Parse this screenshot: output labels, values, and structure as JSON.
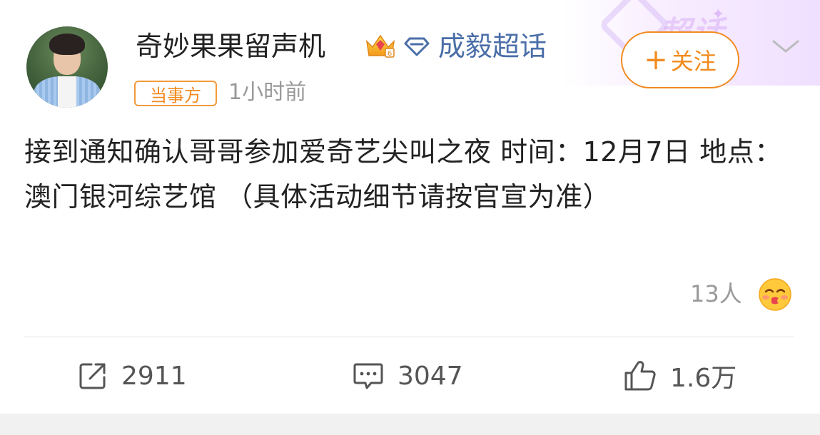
{
  "header": {
    "username": "奇妙果果留声机",
    "topic_name": "成毅超话",
    "follow_label": "关注",
    "follow_plus": "+",
    "role_badge": "当事方",
    "post_time": "1小时前",
    "chaohua_bg_text": "超话"
  },
  "post": {
    "text": "接到通知确认哥哥参加爱奇艺尖叫之夜 时间：12月7日 地点：澳门银河综艺馆 （具体活动细节请按官宣为准）"
  },
  "reactions": {
    "count": "13人",
    "emoji": "kiss-emoji"
  },
  "actions": {
    "share_count": "2911",
    "comment_count": "3047",
    "like_count": "1.6万"
  },
  "colors": {
    "accent_orange": "#f28a1e",
    "topic_blue": "#4a6ea8",
    "muted_gray": "#999999",
    "text": "#222222"
  },
  "icons": {
    "crown": "crown-badge-icon",
    "topic": "diamond-topic-icon",
    "chevron": "chevron-down-icon",
    "share": "share-icon",
    "comment": "comment-icon",
    "like": "thumbs-up-icon"
  }
}
